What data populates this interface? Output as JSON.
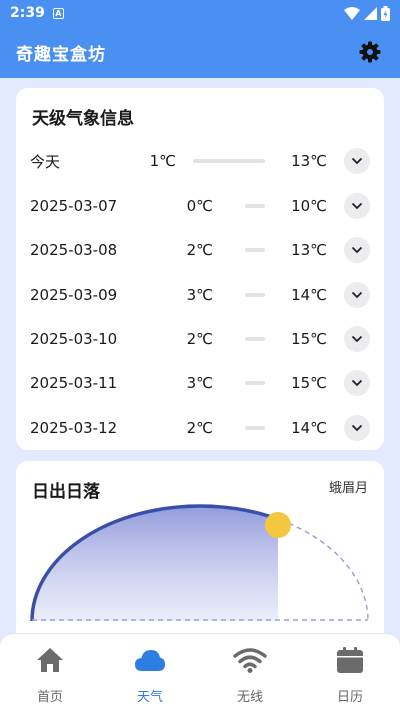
{
  "status_bar": {
    "time": "2:39",
    "notification_letter": "A"
  },
  "app_bar": {
    "title": "奇趣宝盒坊"
  },
  "forecast": {
    "title": "天级气象信息",
    "days": [
      {
        "label": "今天",
        "low": "1℃",
        "high": "13℃"
      },
      {
        "label": "2025-03-07",
        "low": "0℃",
        "high": "10℃"
      },
      {
        "label": "2025-03-08",
        "low": "2℃",
        "high": "13℃"
      },
      {
        "label": "2025-03-09",
        "low": "3℃",
        "high": "14℃"
      },
      {
        "label": "2025-03-10",
        "low": "2℃",
        "high": "15℃"
      },
      {
        "label": "2025-03-11",
        "low": "3℃",
        "high": "15℃"
      },
      {
        "label": "2025-03-12",
        "low": "2℃",
        "high": "14℃"
      }
    ]
  },
  "sun": {
    "title": "日出日落",
    "moon_phase": "蛾眉月"
  },
  "nav": {
    "active": "天气",
    "items": [
      {
        "label": "首页",
        "icon": "home-icon"
      },
      {
        "label": "天气",
        "icon": "cloud-icon"
      },
      {
        "label": "无线",
        "icon": "wifi-icon"
      },
      {
        "label": "日历",
        "icon": "calendar-icon"
      }
    ]
  },
  "colors": {
    "primary": "#4a8ff2",
    "background": "#e3eaff",
    "arc": "#3a4fa8",
    "sun": "#f3c83f",
    "nav_active": "#2e7de0"
  }
}
